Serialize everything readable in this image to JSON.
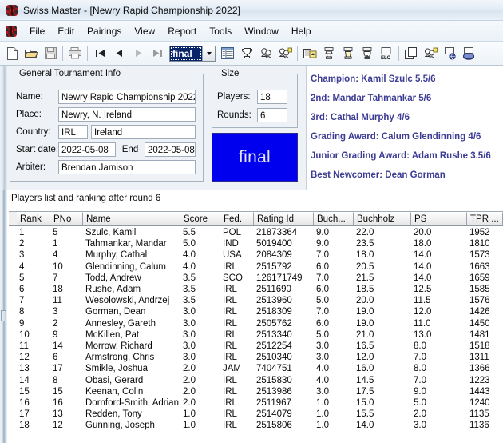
{
  "window": {
    "title": "Swiss Master - [Newry Rapid Championship 2022]",
    "app_icon": "swissmaster-bug-icon"
  },
  "menu": {
    "items": [
      {
        "label": "File"
      },
      {
        "label": "Edit"
      },
      {
        "label": "Pairings"
      },
      {
        "label": "View"
      },
      {
        "label": "Report"
      },
      {
        "label": "Tools"
      },
      {
        "label": "Window"
      },
      {
        "label": "Help"
      }
    ]
  },
  "toolbar": {
    "round_selector_value": "final",
    "buttons": [
      {
        "name": "new-document-icon"
      },
      {
        "name": "open-folder-icon"
      },
      {
        "name": "save-disk-icon"
      },
      {
        "name": "print-icon"
      },
      {
        "name": "first-round-icon"
      },
      {
        "name": "previous-round-icon"
      },
      {
        "name": "next-round-icon"
      },
      {
        "name": "last-round-icon"
      },
      {
        "name": "players-list-icon"
      },
      {
        "name": "standings-trophy-icon"
      },
      {
        "name": "pairings-icon"
      },
      {
        "name": "pairings-results-icon"
      },
      {
        "name": "enter-results-icon"
      },
      {
        "name": "player-card-icon"
      },
      {
        "name": "crosstable-icon"
      },
      {
        "name": "final-ranking-icon"
      },
      {
        "name": "elo-report-icon"
      },
      {
        "name": "copy-report-icon"
      },
      {
        "name": "team-pairings-icon"
      },
      {
        "name": "publish-web-icon"
      },
      {
        "name": "export-fide-icon"
      }
    ]
  },
  "general_info": {
    "group_title": "General Tournament Info",
    "fields": {
      "name_label": "Name:",
      "name_value": "Newry Rapid Championship 2022",
      "place_label": "Place:",
      "place_value": "Newry, N. Ireland",
      "country_label": "Country:",
      "country_code": "IRL",
      "country_value": "Ireland",
      "start_label": "Start date:",
      "start_value": "2022-05-08",
      "end_label": "End",
      "end_value": "2022-05-08",
      "arbiter_label": "Arbiter:",
      "arbiter_value": "Brendan Jamison"
    }
  },
  "size": {
    "group_title": "Size",
    "players_label": "Players:",
    "players_value": "18",
    "rounds_label": "Rounds:",
    "rounds_value": "6"
  },
  "status_banner": {
    "text": "final",
    "bg_color": "#0000ee",
    "text_color": "#e8e8ee"
  },
  "awards": {
    "text_color": "#3c3c94",
    "lines": [
      "Champion: Kamil Szulc 5.5/6",
      "2nd: Mandar Tahmankar 5/6",
      "3rd: Cathal Murphy 4/6",
      "Grading Award: Calum Glendinning 4/6",
      "Junior Grading Award: Adam Rushe 3.5/6",
      "Best Newcomer: Dean Gorman"
    ]
  },
  "players_list": {
    "caption": "Players list and ranking after round 6",
    "columns": [
      "Rank",
      "PNo",
      "Name",
      "Score",
      "Fed.",
      "Rating Id",
      "Buch...",
      "Buchholz",
      "PS",
      "TPR ..."
    ],
    "rows": [
      [
        "1",
        "5",
        "Szulc, Kamil",
        "5.5",
        "POL",
        "21873364",
        "9.0",
        "22.0",
        "20.0",
        "1952"
      ],
      [
        "2",
        "1",
        "Tahmankar, Mandar",
        "5.0",
        "IND",
        "5019400",
        "9.0",
        "23.5",
        "18.0",
        "1810"
      ],
      [
        "3",
        "4",
        "Murphy, Cathal",
        "4.0",
        "USA",
        "2084309",
        "7.0",
        "18.0",
        "14.0",
        "1573"
      ],
      [
        "4",
        "10",
        "Glendinning, Calum",
        "4.0",
        "IRL",
        "2515792",
        "6.0",
        "20.5",
        "14.0",
        "1663"
      ],
      [
        "5",
        "7",
        "Todd, Andrew",
        "3.5",
        "SCO",
        "126171749",
        "7.0",
        "21.5",
        "14.0",
        "1659"
      ],
      [
        "6",
        "18",
        "Rushe, Adam",
        "3.5",
        "IRL",
        "2511690",
        "6.0",
        "18.5",
        "12.5",
        "1585"
      ],
      [
        "7",
        "11",
        "Wesolowski, Andrzej",
        "3.5",
        "IRL",
        "2513960",
        "5.0",
        "20.0",
        "11.5",
        "1576"
      ],
      [
        "8",
        "3",
        "Gorman, Dean",
        "3.0",
        "IRL",
        "2518309",
        "7.0",
        "19.0",
        "12.0",
        "1426"
      ],
      [
        "9",
        "2",
        "Annesley, Gareth",
        "3.0",
        "IRL",
        "2505762",
        "6.0",
        "19.0",
        "11.0",
        "1450"
      ],
      [
        "10",
        "9",
        "McKillen, Pat",
        "3.0",
        "IRL",
        "2513340",
        "5.0",
        "21.0",
        "13.0",
        "1481"
      ],
      [
        "11",
        "14",
        "Morrow, Richard",
        "3.0",
        "IRL",
        "2512254",
        "3.0",
        "16.5",
        "8.0",
        "1518"
      ],
      [
        "12",
        "6",
        "Armstrong, Chris",
        "3.0",
        "IRL",
        "2510340",
        "3.0",
        "12.0",
        "7.0",
        "1311"
      ],
      [
        "13",
        "17",
        "Smikle, Joshua",
        "2.0",
        "JAM",
        "7404751",
        "4.0",
        "16.0",
        "8.0",
        "1366"
      ],
      [
        "14",
        "8",
        "Obasi, Gerard",
        "2.0",
        "IRL",
        "2515830",
        "4.0",
        "14.5",
        "7.0",
        "1223"
      ],
      [
        "15",
        "15",
        "Keenan, Colin",
        "2.0",
        "IRL",
        "2513986",
        "3.0",
        "17.5",
        "9.0",
        "1443"
      ],
      [
        "16",
        "16",
        "Dornford-Smith, Adrian",
        "2.0",
        "IRL",
        "2511967",
        "1.0",
        "15.0",
        "5.0",
        "1240"
      ],
      [
        "17",
        "13",
        "Redden, Tony",
        "1.0",
        "IRL",
        "2514079",
        "1.0",
        "15.5",
        "2.0",
        "1135"
      ],
      [
        "18",
        "12",
        "Gunning, Joseph",
        "1.0",
        "IRL",
        "2515806",
        "1.0",
        "14.0",
        "3.0",
        "1136"
      ]
    ]
  }
}
